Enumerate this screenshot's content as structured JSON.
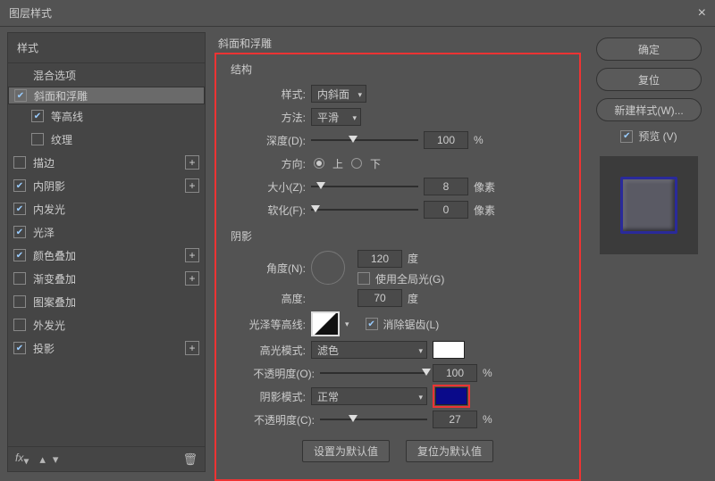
{
  "window": {
    "title": "图层样式",
    "close": "×"
  },
  "left": {
    "header": "样式",
    "items": [
      {
        "label": "混合选项",
        "checked": null,
        "plus": false,
        "indent": false,
        "sel": false,
        "hl": false
      },
      {
        "label": "斜面和浮雕",
        "checked": true,
        "plus": false,
        "indent": false,
        "sel": true,
        "hl": true
      },
      {
        "label": "等高线",
        "checked": true,
        "plus": false,
        "indent": true,
        "sel": false,
        "hl": false
      },
      {
        "label": "纹理",
        "checked": false,
        "plus": false,
        "indent": true,
        "sel": false,
        "hl": false
      },
      {
        "label": "描边",
        "checked": false,
        "plus": true,
        "indent": false,
        "sel": false,
        "hl": false
      },
      {
        "label": "内阴影",
        "checked": true,
        "plus": true,
        "indent": false,
        "sel": false,
        "hl": false
      },
      {
        "label": "内发光",
        "checked": true,
        "plus": false,
        "indent": false,
        "sel": false,
        "hl": false
      },
      {
        "label": "光泽",
        "checked": true,
        "plus": false,
        "indent": false,
        "sel": false,
        "hl": false
      },
      {
        "label": "颜色叠加",
        "checked": true,
        "plus": true,
        "indent": false,
        "sel": false,
        "hl": false
      },
      {
        "label": "渐变叠加",
        "checked": false,
        "plus": true,
        "indent": false,
        "sel": false,
        "hl": false
      },
      {
        "label": "图案叠加",
        "checked": false,
        "plus": false,
        "indent": false,
        "sel": false,
        "hl": false
      },
      {
        "label": "外发光",
        "checked": false,
        "plus": false,
        "indent": false,
        "sel": false,
        "hl": false
      },
      {
        "label": "投影",
        "checked": true,
        "plus": true,
        "indent": false,
        "sel": false,
        "hl": false
      }
    ],
    "foot": {
      "fx": "fx",
      "trash": "🗑"
    }
  },
  "center": {
    "title": "斜面和浮雕",
    "structure": {
      "header": "结构",
      "style": {
        "label": "样式:",
        "value": "内斜面"
      },
      "technique": {
        "label": "方法:",
        "value": "平滑"
      },
      "depth": {
        "label": "深度(D):",
        "value": "100",
        "unit": "%",
        "pos": 35
      },
      "direction": {
        "label": "方向:",
        "up": "上",
        "down": "下",
        "sel": "up"
      },
      "size": {
        "label": "大小(Z):",
        "value": "8",
        "unit": "像素",
        "pos": 5
      },
      "soften": {
        "label": "软化(F):",
        "value": "0",
        "unit": "像素",
        "pos": 0
      }
    },
    "shading": {
      "header": "阴影",
      "angle": {
        "label": "角度(N):",
        "value": "120",
        "unit": "度"
      },
      "global": {
        "label": "使用全局光(G)",
        "checked": false
      },
      "altitude": {
        "label": "高度:",
        "value": "70",
        "unit": "度"
      },
      "gloss": {
        "label": "光泽等高线:"
      },
      "antialias": {
        "label": "消除锯齿(L)",
        "checked": true
      },
      "hmode": {
        "label": "高光模式:",
        "value": "滤色",
        "color": "#ffffff"
      },
      "hopacity": {
        "label": "不透明度(O):",
        "value": "100",
        "unit": "%",
        "pos": 100
      },
      "smode": {
        "label": "阴影模式:",
        "value": "正常",
        "color": "#0a0a8a"
      },
      "sopacity": {
        "label": "不透明度(C):",
        "value": "27",
        "unit": "%",
        "pos": 27
      }
    },
    "defaults": {
      "set": "设置为默认值",
      "reset": "复位为默认值"
    }
  },
  "right": {
    "ok": "确定",
    "cancel": "复位",
    "newstyle": "新建样式(W)...",
    "preview": {
      "label": "预览 (V)",
      "checked": true
    }
  }
}
